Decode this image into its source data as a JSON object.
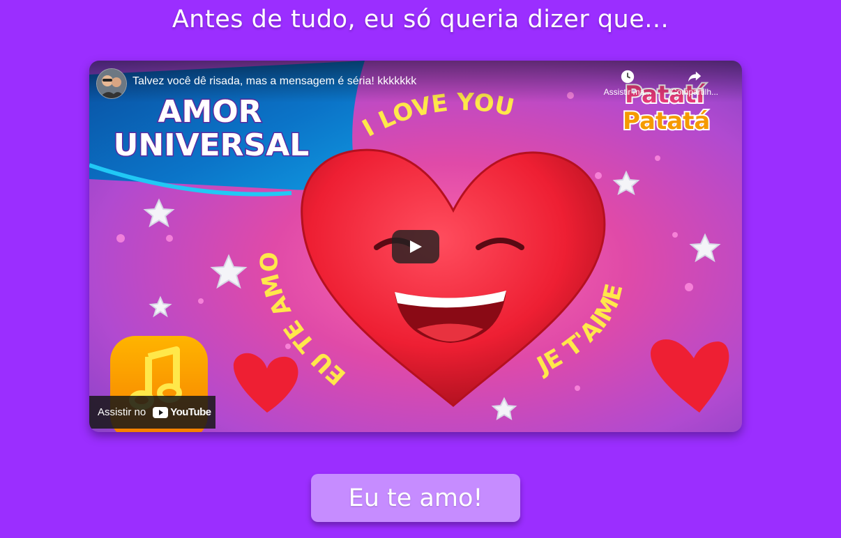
{
  "page": {
    "heading": "Antes de tudo, eu só queria dizer que...",
    "background_color": "#9b2eff"
  },
  "video": {
    "title": "Talvez você dê risada, mas a mensagem é séria! kkkkkkk",
    "watch_later_label": "Assistir ma...",
    "share_label": "Compartilh...",
    "watch_on_label": "Assistir no",
    "youtube_word": "YouTube",
    "thumbnail": {
      "banner_line1": "AMOR",
      "banner_line2": "UNIVERSAL",
      "top_arc_text": "I LOVE YOU",
      "left_arc_text": "EU TE AMO",
      "right_arc_text": "JE T'AIME",
      "logo_line1": "Patatí",
      "logo_line2": "Patatá"
    }
  },
  "cta": {
    "label": "Eu te amo!",
    "color": "#c68cff"
  }
}
